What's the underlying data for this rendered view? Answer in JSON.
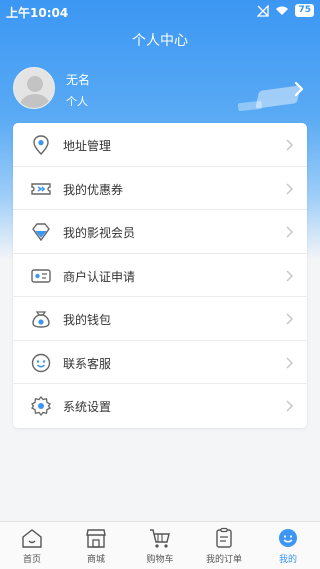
{
  "status_bar": {
    "time": "上午10:04",
    "battery": "75"
  },
  "header": {
    "title": "个人中心"
  },
  "profile": {
    "name": "无名",
    "role": "个人"
  },
  "menu": [
    {
      "label": "地址管理",
      "icon": "location-pin-icon"
    },
    {
      "label": "我的优惠券",
      "icon": "ticket-icon"
    },
    {
      "label": "我的影视会员",
      "icon": "diamond-icon"
    },
    {
      "label": "商户认证申请",
      "icon": "id-card-icon"
    },
    {
      "label": "我的钱包",
      "icon": "wallet-icon"
    },
    {
      "label": "联系客服",
      "icon": "smile-service-icon"
    },
    {
      "label": "系统设置",
      "icon": "gear-icon"
    }
  ],
  "tabbar": [
    {
      "label": "首页",
      "icon": "home-icon",
      "active": false
    },
    {
      "label": "商城",
      "icon": "store-icon",
      "active": false
    },
    {
      "label": "购物车",
      "icon": "cart-icon",
      "active": false
    },
    {
      "label": "我的订单",
      "icon": "order-icon",
      "active": false
    },
    {
      "label": "我的",
      "icon": "user-icon",
      "active": true
    }
  ],
  "colors": {
    "accent": "#3b97f3",
    "text": "#333333",
    "chevron": "#c8c8c8"
  }
}
